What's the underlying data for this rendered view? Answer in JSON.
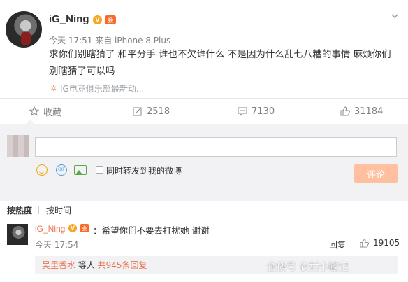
{
  "post": {
    "username": "iG_Ning",
    "verified_badge": "V",
    "member_badge": "会",
    "meta": "今天 17:51 来自 iPhone 8 Plus",
    "content": "求你们别瞎猜了 和平分手 谁也不欠谁什么 不是因为什么乱七八糟的事情 麻烦你们别瞎猜了可以吗",
    "topic": "IG电竞俱乐部最新动..."
  },
  "actions": {
    "favorite": "收藏",
    "repost_count": "2518",
    "comment_count": "7130",
    "like_count": "31184"
  },
  "comment_box": {
    "input_value": "",
    "forward_label": "同时转发到我的微博",
    "submit_label": "评论",
    "gif_label": "GIF"
  },
  "sort": {
    "hot": "按热度",
    "time": "按时间"
  },
  "reply": {
    "username": "iG_Ning",
    "verified_badge": "V",
    "member_badge": "会",
    "text": "：希望你们不要去打扰她 谢谢",
    "time": "今天 17:54",
    "reply_label": "回复",
    "like_count": "19105",
    "sub_user": "吴里香水",
    "sub_middle": " 等人 ",
    "sub_count": "共945条回复"
  },
  "watermark": "企鹅号 农村小敏记",
  "colors": {
    "accent": "#eb7350",
    "submit_bg": "#ffc09f",
    "panel_bg": "#f2f2f5",
    "badge_gold": "#f5a623"
  }
}
